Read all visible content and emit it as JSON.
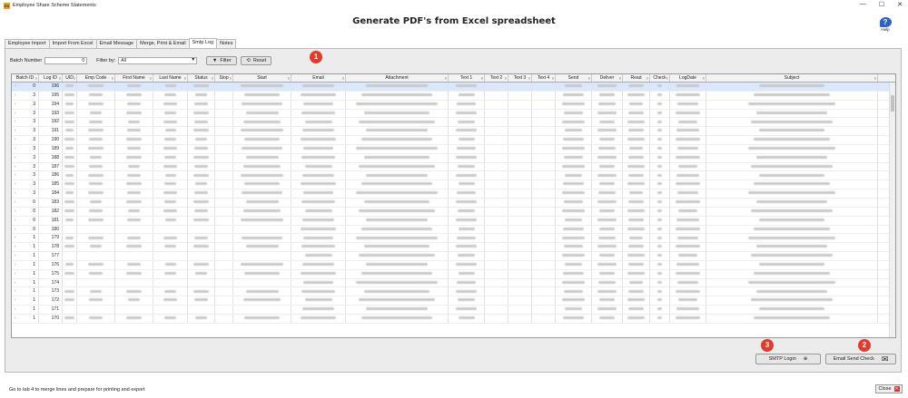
{
  "window": {
    "title": "Employee Share Scheme Statements",
    "minimize": "—",
    "maximize": "☐",
    "close": "✕"
  },
  "header": {
    "title": "Generate PDF's from Excel spreadsheet",
    "help_label": "Help"
  },
  "tabs": [
    "Employee Import",
    "Import From Excel",
    "Email Message",
    "Merge, Print & Email",
    "Smtp Log",
    "Notes"
  ],
  "filter": {
    "batch_label": "Batch Number",
    "batch_value": "0",
    "filter_by_label": "Filter by:",
    "filter_by_value": "All",
    "filter_button": "Filter",
    "reset_button": "Reset"
  },
  "grid": {
    "columns": [
      "Batch ID",
      "Log ID",
      "UID",
      "Emp Code",
      "First Name",
      "Last Name",
      "Status",
      "Stop",
      "Start",
      "Email",
      "Attachment",
      "Text 1",
      "Text 2",
      "Text 3",
      "Text 4",
      "Send",
      "Deliver",
      "Read",
      "Check",
      "LogDate",
      "Subject"
    ],
    "rows": [
      {
        "batch": "0",
        "log": "196"
      },
      {
        "batch": "3",
        "log": "195"
      },
      {
        "batch": "3",
        "log": "194"
      },
      {
        "batch": "3",
        "log": "193"
      },
      {
        "batch": "3",
        "log": "192"
      },
      {
        "batch": "3",
        "log": "191"
      },
      {
        "batch": "3",
        "log": "190"
      },
      {
        "batch": "3",
        "log": "189"
      },
      {
        "batch": "3",
        "log": "188"
      },
      {
        "batch": "3",
        "log": "187"
      },
      {
        "batch": "3",
        "log": "186"
      },
      {
        "batch": "3",
        "log": "185"
      },
      {
        "batch": "3",
        "log": "184"
      },
      {
        "batch": "0",
        "log": "183"
      },
      {
        "batch": "0",
        "log": "182"
      },
      {
        "batch": "0",
        "log": "181"
      },
      {
        "batch": "0",
        "log": "180"
      },
      {
        "batch": "1",
        "log": "179"
      },
      {
        "batch": "1",
        "log": "178"
      },
      {
        "batch": "1",
        "log": "177"
      },
      {
        "batch": "1",
        "log": "176"
      },
      {
        "batch": "1",
        "log": "175"
      },
      {
        "batch": "1",
        "log": "174"
      },
      {
        "batch": "1",
        "log": "173"
      },
      {
        "batch": "1",
        "log": "172"
      },
      {
        "batch": "1",
        "log": "171"
      },
      {
        "batch": "1",
        "log": "170"
      }
    ]
  },
  "buttons": {
    "smtp_login": "SMTP Login",
    "email_send_check": "Email Send Check"
  },
  "badges": [
    "1",
    "2",
    "3"
  ],
  "status": {
    "message": "Go to tab 4 to merge lines and prepare for printing and export",
    "close": "Close"
  },
  "colors": {
    "badge": "#e23b2e",
    "selected_row": "#d9e9fb",
    "help_icon": "#2a62c8"
  }
}
